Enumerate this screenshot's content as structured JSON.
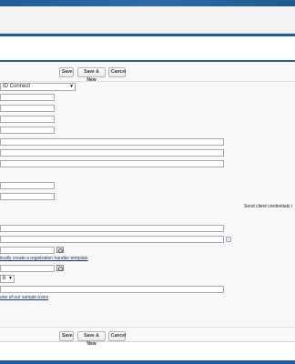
{
  "header": {
    "brand_color": "#1f5c99"
  },
  "toolbar_top": {
    "save_label": "Save",
    "save_new_label": "Save & New",
    "cancel_label": "Cancel"
  },
  "toolbar_bottom": {
    "save_label": "Save",
    "save_new_label": "Save & New",
    "cancel_label": "Cancel"
  },
  "form": {
    "provider_type_value": "ID Connect",
    "send_credentials_label": "Send client credentials i",
    "registration_handler_link": "tically create a registration handler template",
    "icon_sample_link": "one of our sample icons",
    "small_select_value": "b"
  }
}
